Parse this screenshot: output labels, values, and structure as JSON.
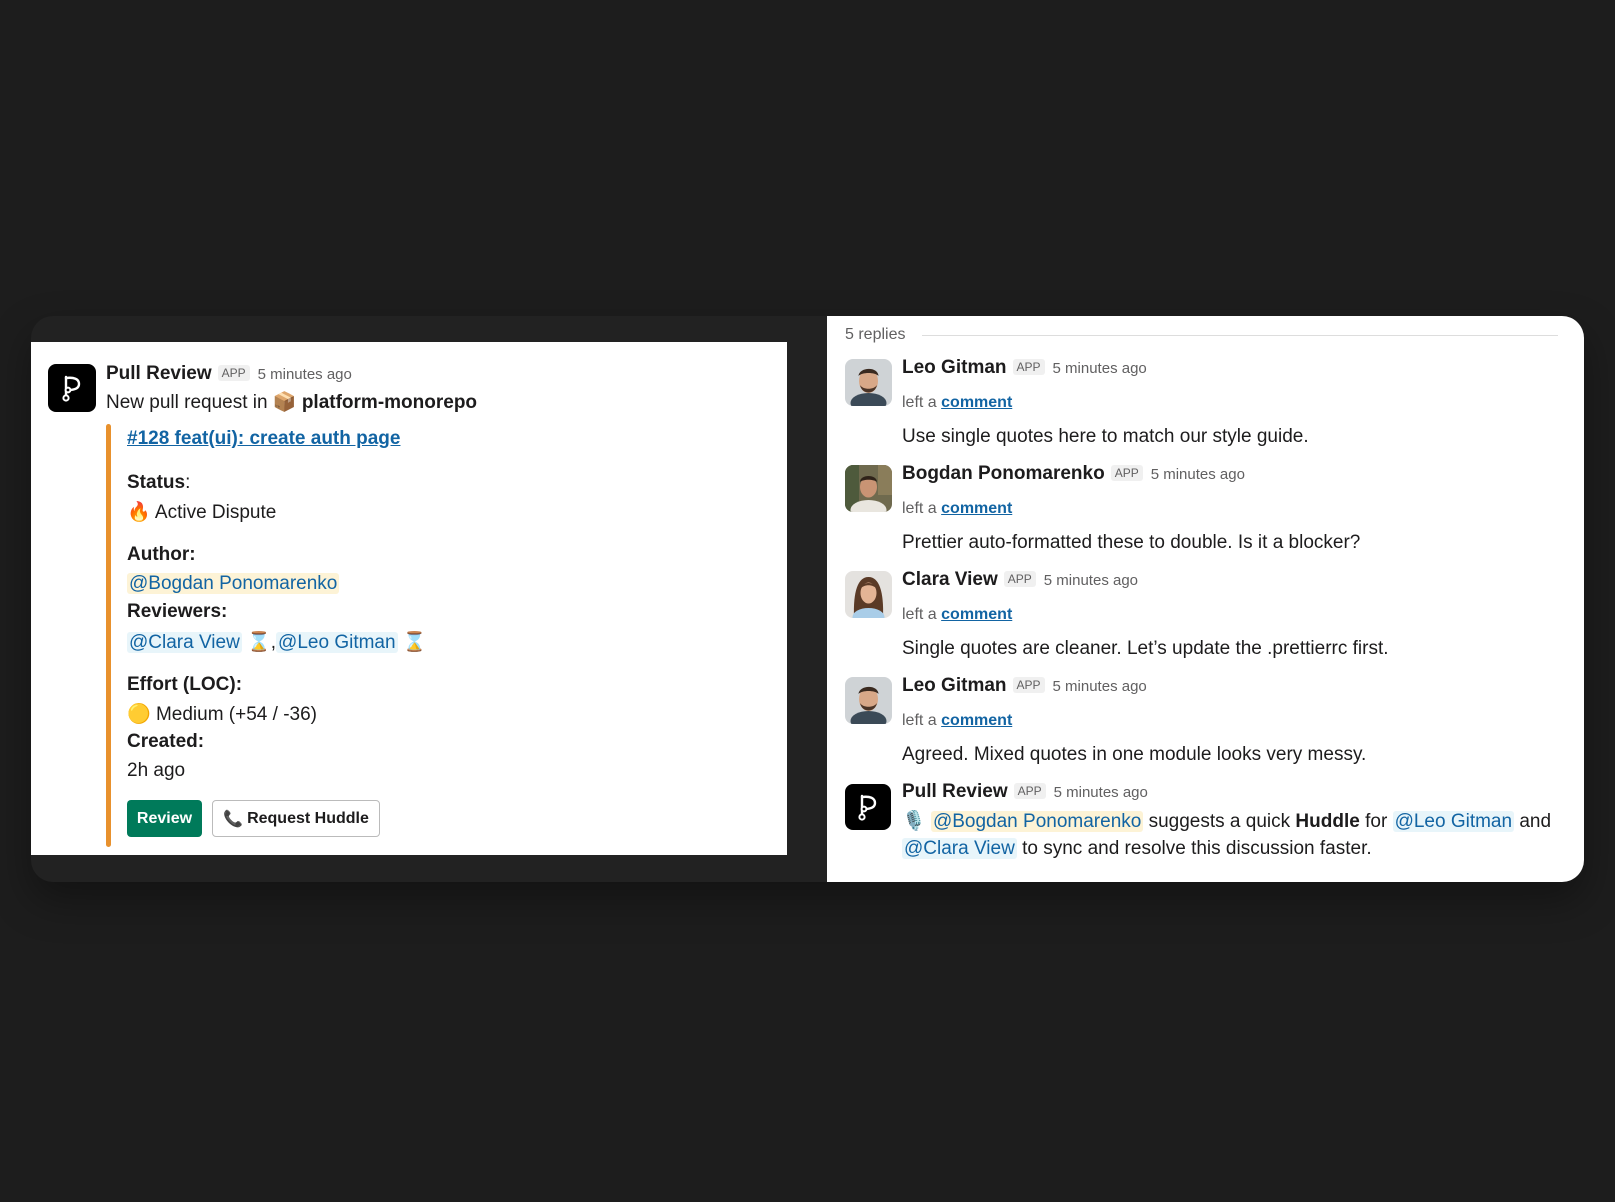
{
  "left_message": {
    "bot_name": "Pull Review",
    "app_badge": "APP",
    "time": "5 minutes ago",
    "intro_text": "New pull request in",
    "repo_emoji": "📦",
    "repo_name": "platform-monorepo",
    "pr_title": "#128 feat(ui): create auth page",
    "status_label": "Status",
    "status_colon": ":",
    "status_emoji": "🔥",
    "status_value": "Active Dispute",
    "author_label": "Author:",
    "author_mention": "@Bogdan Ponomarenko",
    "reviewers_label": "Reviewers:",
    "reviewer_1": "@Clara View",
    "reviewer_2": "@Leo Gitman",
    "hourglass": "⌛",
    "comma": ",",
    "effort_label": "Effort (LOC):",
    "effort_emoji": "🟡",
    "effort_value": "Medium (+54 / -36)",
    "created_label": "Created:",
    "created_value": "2h ago",
    "review_button": "Review",
    "huddle_icon": "📞",
    "huddle_button": "Request Huddle"
  },
  "thread": {
    "replies_count": "5 replies",
    "replies": [
      {
        "name": "Leo Gitman",
        "badge": "APP",
        "time": "5 minutes ago",
        "prefix": "left a",
        "link": "comment",
        "text": "Use single quotes here to match our style guide."
      },
      {
        "name": "Bogdan Ponomarenko",
        "badge": "APP",
        "time": "5 minutes ago",
        "prefix": "left a",
        "link": "comment",
        "text": "Prettier auto-formatted these to double. Is it a blocker?"
      },
      {
        "name": "Clara View",
        "badge": "APP",
        "time": "5 minutes ago",
        "prefix": "left a",
        "link": "comment",
        "text": "Single quotes are cleaner. Let’s update the .prettierrc first."
      },
      {
        "name": "Leo Gitman",
        "badge": "APP",
        "time": "5 minutes ago",
        "prefix": "left a",
        "link": "comment",
        "text": "Agreed. Mixed quotes in one module looks very messy."
      }
    ],
    "final": {
      "name": "Pull Review",
      "badge": "APP",
      "time": "5 minutes ago",
      "mic": "🎙️",
      "mention_1": "@Bogdan Ponomarenko",
      "text_1": "suggests a quick",
      "bold": "Huddle",
      "text_2": "for",
      "mention_2": "@Leo Gitman",
      "text_3": "and",
      "mention_3": "@Clara View",
      "text_4": "to sync and resolve this discussion faster."
    }
  }
}
